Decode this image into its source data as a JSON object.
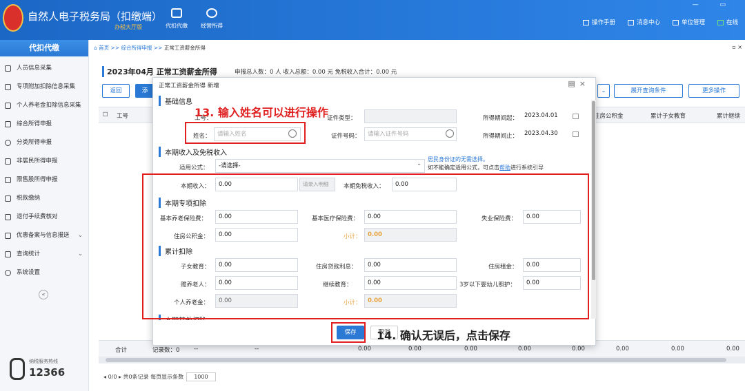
{
  "app": {
    "title": "自然人电子税务局（扣缴端）",
    "hall": "办税大厅版"
  },
  "toolbar": {
    "withhold": "代扣代缴",
    "business": "经营所得"
  },
  "top_links": [
    "操作手册",
    "消息中心",
    "单位管理",
    "在线"
  ],
  "sidebar": {
    "header": "代扣代缴",
    "items": [
      "人员信息采集",
      "专项附加扣除信息采集",
      "个人养老金扣除信息采集",
      "综合所得申报",
      "分类所得申报",
      "非居民所得申报",
      "限售股所得申报",
      "税款缴纳",
      "退付手续费核对",
      "优惠备案与信息报送",
      "查询统计",
      "系统设置"
    ],
    "hotline_label": "纳税服务热线",
    "hotline": "12366"
  },
  "breadcrumb": {
    "home": "首页",
    "sep1": " >> ",
    "mid": "综合所得申报",
    "sep2": " >> ",
    "current": "正常工资薪金所得"
  },
  "main": {
    "title": "2023年04月 正常工资薪金所得",
    "stats": "申报总人数：0 人  收入总额：0.00 元  免税收入合计：0.00 元",
    "back": "返回",
    "add": "添",
    "expand": "展开查询条件",
    "more": "更多操作",
    "headers": [
      "工号",
      "住房公积金",
      "累计子女教育",
      "累计继续"
    ],
    "footer": {
      "total": "合计",
      "records": "记录数：0",
      "dash1": "--",
      "dash2": "--",
      "vals": [
        "0.00",
        "0.00",
        "0.00",
        "0.00",
        "0.00",
        "0.00",
        "0.00",
        "0.00"
      ]
    },
    "pager": {
      "pos": "0/0",
      "count": "共0条记录",
      "per_page_label": "每页显示条数",
      "per_page": "1000"
    }
  },
  "modal": {
    "title": "正常工资薪金所得 新增",
    "sec_basic": "基础信息",
    "worker_no": "工号：",
    "id_type": "证件类型：",
    "name_label": "姓名：",
    "name_ph": "请输入姓名",
    "id_no_label": "证件号码：",
    "id_no_ph": "请输入证件号码",
    "period_start_label": "所得期间起：",
    "period_start": "2023.04.01",
    "period_end_label": "所得期间止：",
    "period_end": "2023.04.30",
    "sec_income": "本期收入及免税收入",
    "formula_label": "适用公式：",
    "formula": "-请选择-",
    "note1": "居民身份证的无需选择。",
    "note2a": "如不能确定适用公式，可点击",
    "note2b": "帮助",
    "note2c": "进行系统引导",
    "income_label": "本期收入：",
    "income": "0.00",
    "detail_btn": "请录入明细",
    "exempt_label": "本期免税收入：",
    "exempt": "0.00",
    "sec_special": "本期专项扣除",
    "pension_label": "基本养老保险费：",
    "pension": "0.00",
    "medical_label": "基本医疗保险费：",
    "medical": "0.00",
    "unemp_label": "失业保险费：",
    "unemp": "0.00",
    "housing_label": "住房公积金：",
    "housing": "0.00",
    "subtotal_label": "小计：",
    "subtotal1": "0.00",
    "sec_cumulative": "累计扣除",
    "child_label": "子女教育：",
    "child": "0.00",
    "loan_label": "住房贷款利息：",
    "loan": "0.00",
    "rent_label": "住房租金：",
    "rent": "0.00",
    "elder_label": "赡养老人：",
    "elder": "0.00",
    "cont_label": "继续教育：",
    "cont": "0.00",
    "infant_label": "3岁以下婴幼儿照护：",
    "infant": "0.00",
    "perspen_label": "个人养老金：",
    "perspen": "0.00",
    "subtotal2": "0.00",
    "sec_other": "本期其他扣除",
    "save": "保存",
    "cancel": "取消"
  },
  "annotations": {
    "step13": "13. 输入姓名可以进行操作",
    "step14": "14. 确认无误后，点击保存"
  },
  "colors": {
    "primary": "#2a79d4",
    "annotation": "#e02020",
    "subtotal": "#e6a23c"
  }
}
